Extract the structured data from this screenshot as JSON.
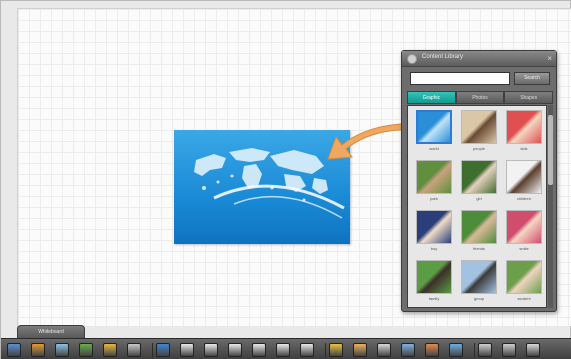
{
  "library": {
    "title": "Content Library",
    "search_placeholder": "",
    "search_button": "Search",
    "close_glyph": "×",
    "tabs": [
      {
        "label": "Graphic",
        "active": true
      },
      {
        "label": "Photos",
        "active": false
      },
      {
        "label": "Shapes",
        "active": false
      }
    ],
    "thumbnails": [
      {
        "label": "world",
        "colors": [
          "#2b8fd8",
          "#bfe2f7"
        ]
      },
      {
        "label": "people",
        "colors": [
          "#d9c7a7",
          "#6b4a34"
        ]
      },
      {
        "label": "kids",
        "colors": [
          "#e05050",
          "#f4d6c2"
        ]
      },
      {
        "label": "park",
        "colors": [
          "#5f8f3f",
          "#c9a27d"
        ]
      },
      {
        "label": "girl",
        "colors": [
          "#3f6f2f",
          "#e6d0c0"
        ]
      },
      {
        "label": "children",
        "colors": [
          "#f2f2f2",
          "#5a3d2c"
        ]
      },
      {
        "label": "boy",
        "colors": [
          "#2a3f7a",
          "#f1dcc8"
        ]
      },
      {
        "label": "friends",
        "colors": [
          "#4d8d3a",
          "#dbb89a"
        ]
      },
      {
        "label": "smile",
        "colors": [
          "#d14d6c",
          "#f4d7c4"
        ]
      },
      {
        "label": "family",
        "colors": [
          "#5b9c44",
          "#3d2e2a"
        ]
      },
      {
        "label": "group",
        "colors": [
          "#a3c2e1",
          "#3a3a3a"
        ]
      },
      {
        "label": "student",
        "colors": [
          "#6d9f4b",
          "#eed4c0"
        ]
      }
    ]
  },
  "whiteboard_tab": "Whiteboard",
  "toolbar": {
    "icons": [
      {
        "name": "pointer-tool-icon",
        "color": "#5b8fd0"
      },
      {
        "name": "image-tool-icon",
        "color": "#e39a35"
      },
      {
        "name": "text-tool-icon",
        "color": "#8fc2e6"
      },
      {
        "name": "shape-tool-icon",
        "color": "#66b04a"
      },
      {
        "name": "folder-tool-icon",
        "color": "#e7b940"
      },
      {
        "name": "page-tool-icon",
        "color": "#c8c8c8"
      },
      {
        "name": "pen-blue-icon",
        "color": "#3d86d4"
      },
      {
        "name": "pen-white-icon",
        "color": "#e9e9e9"
      },
      {
        "name": "pen-white-icon",
        "color": "#e9e9e9"
      },
      {
        "name": "pen-white-icon",
        "color": "#e9e9e9"
      },
      {
        "name": "pen-white-icon",
        "color": "#e9e9e9"
      },
      {
        "name": "pen-white-icon",
        "color": "#e9e9e9"
      },
      {
        "name": "pen-white-icon",
        "color": "#e9e9e9"
      },
      {
        "name": "highlighter-icon",
        "color": "#e7c540"
      },
      {
        "name": "eraser-icon",
        "color": "#f0b060"
      },
      {
        "name": "text-box-icon",
        "color": "#d8d8d8"
      },
      {
        "name": "grid-icon",
        "color": "#7fb2e2"
      },
      {
        "name": "camera-icon",
        "color": "#e58a4c"
      },
      {
        "name": "screen-icon",
        "color": "#6ab0e8"
      },
      {
        "name": "undo-icon",
        "color": "#cfcfcf"
      },
      {
        "name": "redo-icon",
        "color": "#cfcfcf"
      },
      {
        "name": "delete-icon",
        "color": "#d9d9d9"
      }
    ]
  }
}
